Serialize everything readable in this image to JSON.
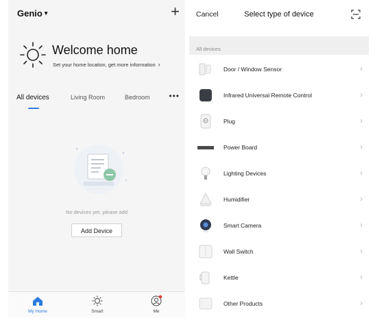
{
  "left": {
    "home_name": "Genio",
    "welcome_title": "Welcome home",
    "welcome_subtitle": "Set your home location, get more information",
    "tabs": [
      "All devices",
      "Living Room",
      "Bedroom"
    ],
    "empty_text": "No devices yet, please add",
    "add_button": "Add Device",
    "tabbar": [
      "My Home",
      "Smart",
      "Me"
    ]
  },
  "right": {
    "cancel": "Cancel",
    "title": "Select type of device",
    "section": "All devices",
    "devices": [
      {
        "label": "Door / Window Sensor",
        "icon": "door-sensor-icon"
      },
      {
        "label": "Infrared Universal Remote Control",
        "icon": "ir-remote-icon"
      },
      {
        "label": "Plug",
        "icon": "plug-icon"
      },
      {
        "label": "Power Board",
        "icon": "power-board-icon"
      },
      {
        "label": "Lighting Devices",
        "icon": "bulb-icon"
      },
      {
        "label": "Humidifier",
        "icon": "humidifier-icon"
      },
      {
        "label": "Smart Camera",
        "icon": "camera-icon"
      },
      {
        "label": "Wall Switch",
        "icon": "wall-switch-icon"
      },
      {
        "label": "Kettle",
        "icon": "kettle-icon"
      },
      {
        "label": "Other Products",
        "icon": "other-products-icon"
      }
    ]
  },
  "colors": {
    "accent": "#2d7be0",
    "badge": "#e53935"
  }
}
